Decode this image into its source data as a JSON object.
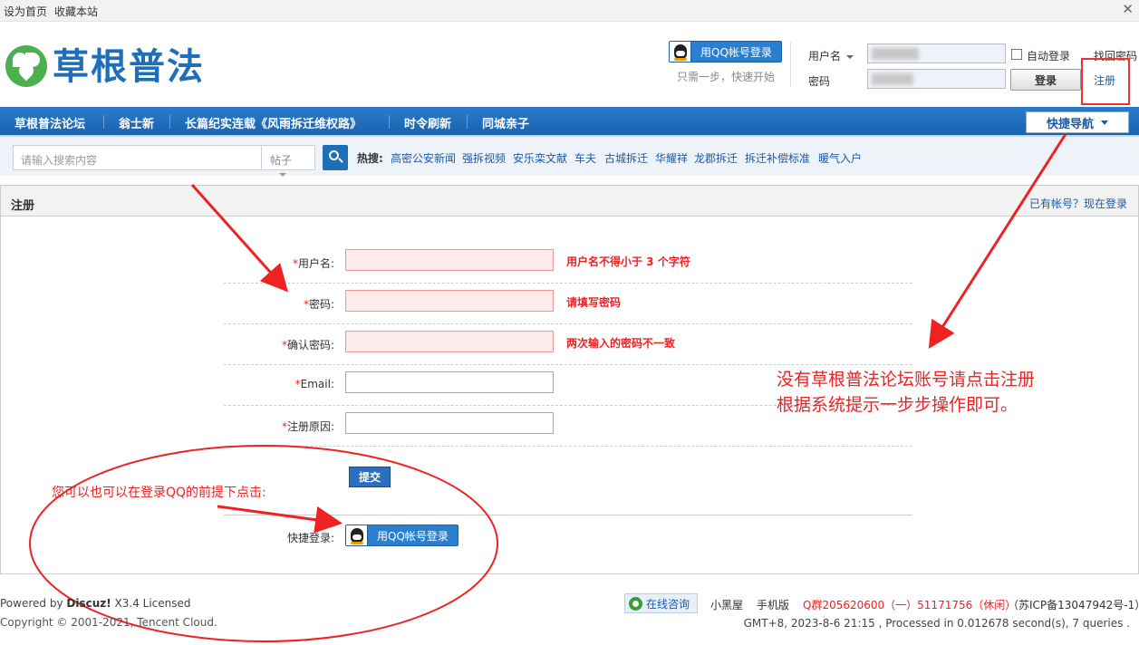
{
  "topbar": {
    "set_home": "设为首页",
    "bookmark": "收藏本站"
  },
  "header": {
    "logo_text": "草根普法",
    "qq_login": "用QQ帐号登录",
    "qq_hint": "只需一步，快速开始",
    "username_label": "用户名",
    "password_label": "密码",
    "auto_login": "自动登录",
    "login_button": "登录",
    "find_password": "找回密码",
    "register": "注册"
  },
  "nav": {
    "items": [
      "草根普法论坛",
      "翁士新",
      "长篇纪实连载《风雨拆迁维权路》",
      "时令刷新",
      "同城亲子"
    ],
    "quick_nav": "快捷导航"
  },
  "search": {
    "placeholder": "请输入搜索内容",
    "type": "帖子",
    "hot_label": "热搜:",
    "hot": [
      "高密公安新闻",
      "强拆视频",
      "安乐栾文献",
      "车夫",
      "古城拆迁",
      "华耀祥",
      "龙郡拆迁",
      "拆迁补偿标准",
      "暖气入户"
    ]
  },
  "panel": {
    "title": "注册",
    "login_link": "已有帐号？现在登录"
  },
  "form": {
    "fields": [
      {
        "label": "用户名:",
        "tip": "用户名不得小于 3 个字符"
      },
      {
        "label": "密码:",
        "tip": "请填写密码"
      },
      {
        "label": "确认密码:",
        "tip": "两次输入的密码不一致"
      },
      {
        "label": "Email:",
        "tip": ""
      },
      {
        "label": "注册原因:",
        "tip": ""
      }
    ],
    "required_mark": "*",
    "submit": "提交",
    "quick_login_label": "快捷登录:",
    "qq_login": "用QQ帐号登录"
  },
  "annotations": {
    "qq_note": "您可以也可以在登录QQ的前提下点击:",
    "register_note_line1": "没有草根普法论坛账号请点击注册",
    "register_note_line2": "根据系统提示一步步操作即可。"
  },
  "footer": {
    "powered_prefix": "Powered by ",
    "powered_brand": "Discuz!",
    "powered_suffix": " X3.4 Licensed",
    "copyright": "Copyright © 2001-2021, Tencent Cloud.",
    "consult": "在线咨询",
    "blacklist": "小黑屋",
    "mobile": "手机版",
    "qq_group": "Q群205620600（一）51171756（休闲）",
    "icp": "（苏ICP备13047942号-1）",
    "stats": "GMT+8, 2023-8-6 21:15 , Processed in 0.012678 second(s), 7 queries ."
  },
  "colors": {
    "accent": "#1d6fb8",
    "annotation": "#e22222",
    "error_bg": "#fdeaea"
  }
}
